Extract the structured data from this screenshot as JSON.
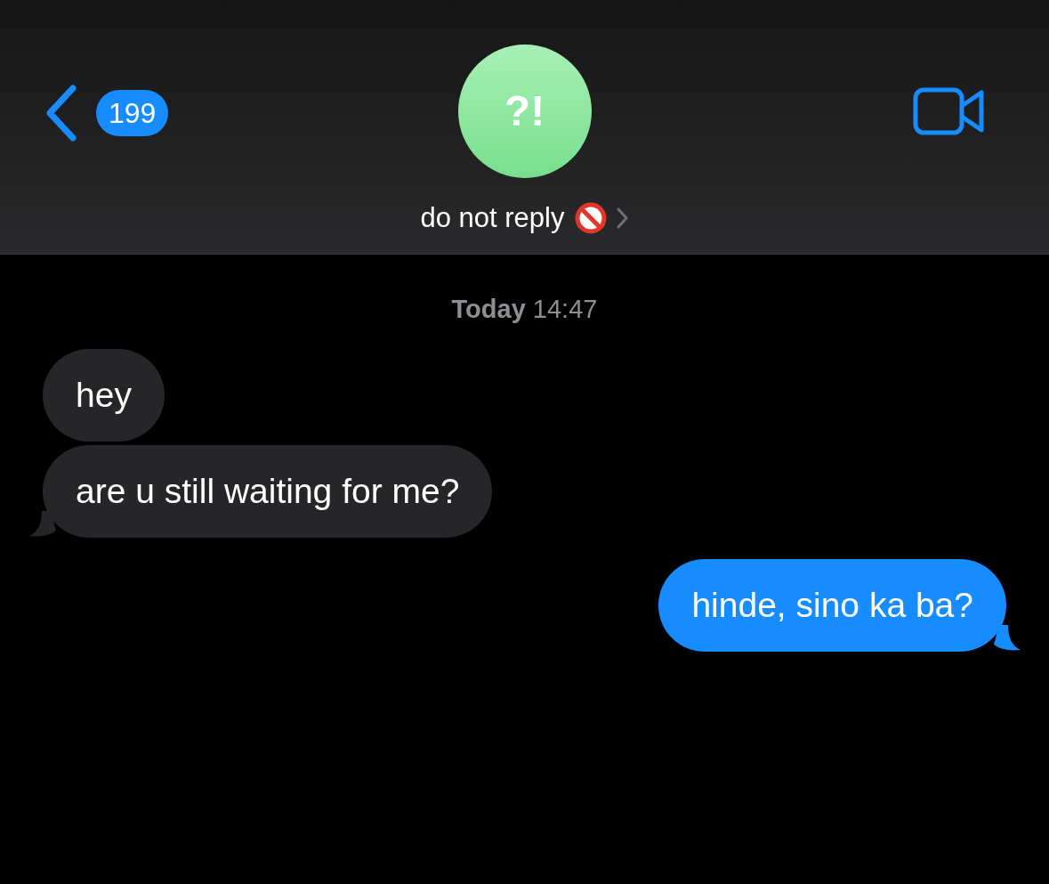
{
  "header": {
    "back_count": "199",
    "avatar_text": "?!",
    "contact_name": "do not reply"
  },
  "timestamp": "**Today** 14:47",
  "messages": [
    {
      "kind": "received",
      "text": "hey",
      "tail": false
    },
    {
      "kind": "received",
      "text": "are u still waiting for me?",
      "tail": true
    },
    {
      "kind": "sent",
      "text": "hinde, sino ka ba?",
      "tail": true
    }
  ]
}
